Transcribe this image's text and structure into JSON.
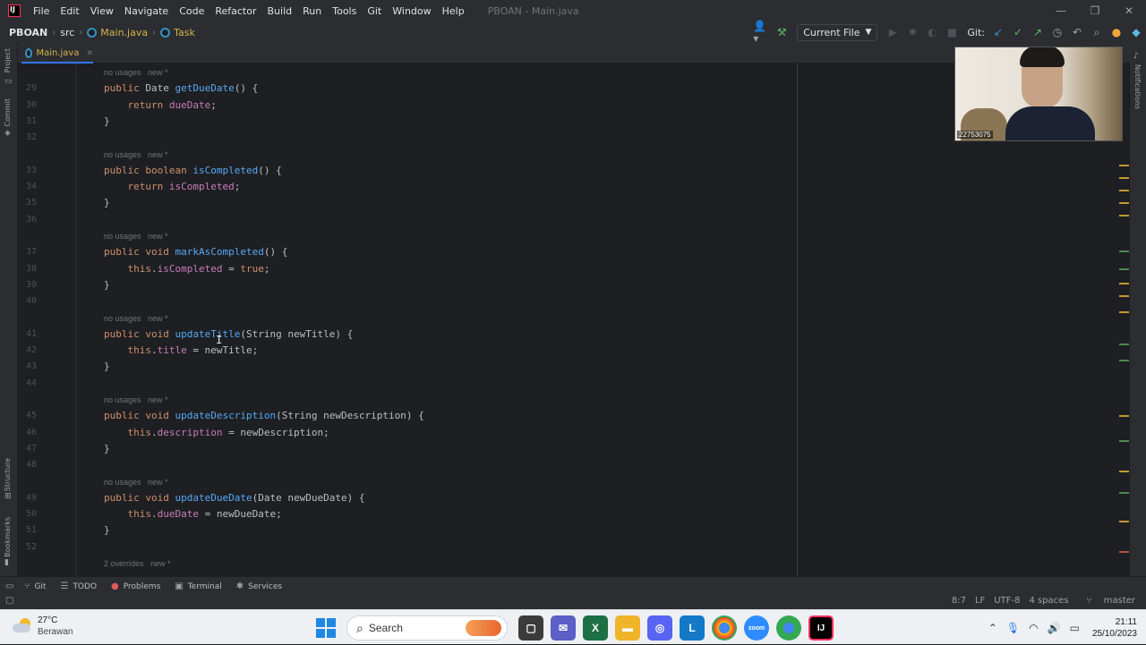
{
  "menubar": {
    "items": [
      "File",
      "Edit",
      "View",
      "Navigate",
      "Code",
      "Refactor",
      "Build",
      "Run",
      "Tools",
      "Git",
      "Window",
      "Help"
    ],
    "window_title": "PBOAN - Main.java"
  },
  "navbar": {
    "project": "PBOAN",
    "src": "src",
    "file1": "Main.java",
    "file2": "Task",
    "run_config": "Current File",
    "git_label": "Git:"
  },
  "left_strip": {
    "project": "Project",
    "commit": "Commit",
    "structure": "Structure",
    "bookmarks": "Bookmarks"
  },
  "right_strip": {
    "notifications": "Notifications"
  },
  "editor_tab": {
    "label": "Main.java"
  },
  "code_lines": [
    {
      "type": "hint",
      "text": "no usages   new *"
    },
    {
      "type": "code",
      "ln": "29",
      "text": "public Date getDueDate() {"
    },
    {
      "type": "code",
      "ln": "30",
      "text": "    return dueDate;"
    },
    {
      "type": "code",
      "ln": "31",
      "text": "}"
    },
    {
      "type": "code",
      "ln": "32",
      "text": ""
    },
    {
      "type": "hint",
      "text": "no usages   new *"
    },
    {
      "type": "code",
      "ln": "33",
      "text": "public boolean isCompleted() {"
    },
    {
      "type": "code",
      "ln": "34",
      "text": "    return isCompleted;"
    },
    {
      "type": "code",
      "ln": "35",
      "text": "}"
    },
    {
      "type": "code",
      "ln": "36",
      "text": ""
    },
    {
      "type": "hint",
      "text": "no usages   new *"
    },
    {
      "type": "code",
      "ln": "37",
      "text": "public void markAsCompleted() {"
    },
    {
      "type": "code",
      "ln": "38",
      "text": "    this.isCompleted = true;"
    },
    {
      "type": "code",
      "ln": "39",
      "text": "}"
    },
    {
      "type": "code",
      "ln": "40",
      "text": ""
    },
    {
      "type": "hint",
      "text": "no usages   new *"
    },
    {
      "type": "code",
      "ln": "41",
      "text": "public void updateTitle(String newTitle) {"
    },
    {
      "type": "code",
      "ln": "42",
      "text": "    this.title = newTitle;"
    },
    {
      "type": "code",
      "ln": "43",
      "text": "}"
    },
    {
      "type": "code",
      "ln": "44",
      "text": ""
    },
    {
      "type": "hint",
      "text": "no usages   new *"
    },
    {
      "type": "code",
      "ln": "45",
      "text": "public void updateDescription(String newDescription) {"
    },
    {
      "type": "code",
      "ln": "46",
      "text": "    this.description = newDescription;"
    },
    {
      "type": "code",
      "ln": "47",
      "text": "}"
    },
    {
      "type": "code",
      "ln": "48",
      "text": ""
    },
    {
      "type": "hint",
      "text": "no usages   new *"
    },
    {
      "type": "code",
      "ln": "49",
      "text": "public void updateDueDate(Date newDueDate) {"
    },
    {
      "type": "code",
      "ln": "50",
      "text": "    this.dueDate = newDueDate;"
    },
    {
      "type": "code",
      "ln": "51",
      "text": "}"
    },
    {
      "type": "code",
      "ln": "52",
      "text": ""
    },
    {
      "type": "hint",
      "text": "2 overrides   new *"
    }
  ],
  "webcam": {
    "label": "22753075"
  },
  "tool_windows": [
    "Git",
    "TODO",
    "Problems",
    "Terminal",
    "Services"
  ],
  "status": {
    "position": "8:7",
    "line_sep": "LF",
    "encoding": "UTF-8",
    "indent": "4 spaces",
    "branch": "master"
  },
  "taskbar": {
    "temperature": "27°C",
    "condition": "Berawan",
    "search_placeholder": "Search",
    "time": "21:11",
    "date": "25/10/2023"
  },
  "colors": {
    "keyword": "#cf8e6d",
    "method": "#56a8f5",
    "field": "#c77dbb",
    "accent": "#3574f0"
  }
}
